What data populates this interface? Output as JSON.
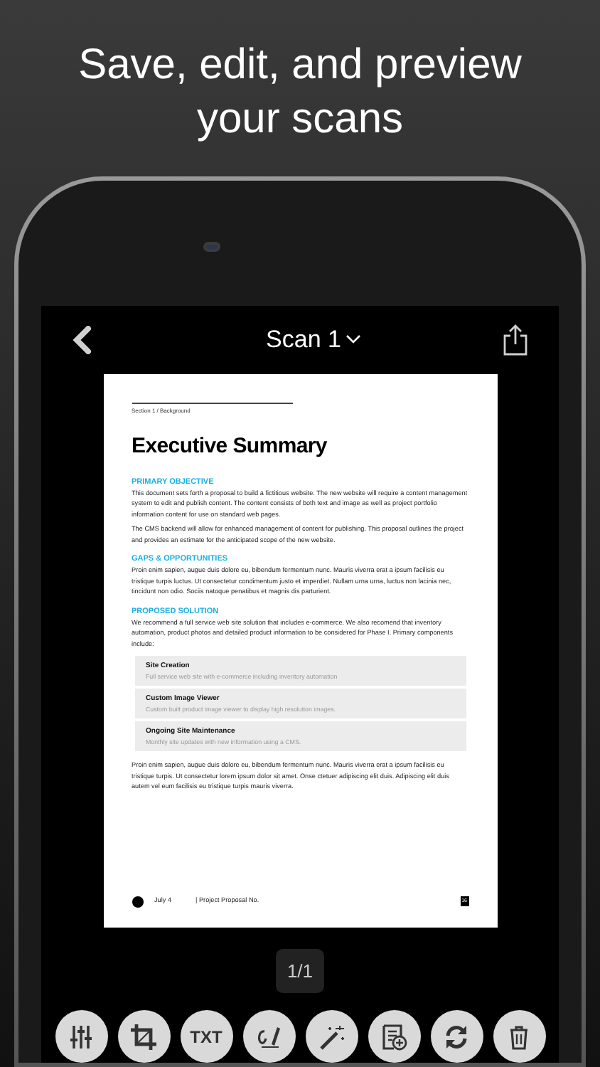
{
  "headline": "Save, edit, and preview your scans",
  "nav": {
    "title": "Scan 1"
  },
  "document": {
    "section_label": "Section 1 / Background",
    "title": "Executive Summary",
    "sections": [
      {
        "heading": "PRIMARY OBJECTIVE",
        "paragraphs": [
          "This document sets forth a proposal to build a fictitious website. The new website will require a content management system to edit and publish content. The content consists of both text and image as well as project portfolio information content for use on standard web pages.",
          "The CMS backend will allow for enhanced management of content for publishing. This proposal outlines the project and provides an estimate for the anticipated scope of the new website."
        ]
      },
      {
        "heading": "GAPS & OPPORTUNITIES",
        "paragraphs": [
          "Proin enim sapien, augue duis dolore eu, bibendum fermentum nunc. Mauris viverra erat a ipsum facilisis eu tristique turpis luctus. Ut consectetur condimentum justo et imperdiet. Nullam urna urna, luctus non lacinia nec, tincidunt non odio. Sociis natoque penatibus et magnis dis parturient."
        ]
      },
      {
        "heading": "PROPOSED SOLUTION",
        "paragraphs": [
          "We recommend a full service web site solution that includes e-commerce. We also recomend that inventory automation, product photos and detailed product information to be considered for Phase I. Primary components include:"
        ],
        "components": [
          {
            "title": "Site Creation",
            "description": "Full service web site with e-commerce including inventory automation"
          },
          {
            "title": "Custom Image Viewer",
            "description": "Custom built product image viewer to display high resolution images."
          },
          {
            "title": "Ongoing Site Maintenance",
            "description": "Monthly site updates with new information using a CMS."
          }
        ]
      }
    ],
    "closing": "Proin enim sapien, augue duis dolore eu, bibendum fermentum nunc. Mauris viverra erat a ipsum facilisis eu tristique turpis. Ut consectetur lorem ipsum dolor sit amet. Onse ctetuer adipiscing elit duis. Adipiscing elit duis autem vel eum facilisis eu tristique turpis mauris viverra.",
    "footer": {
      "date": "July 4",
      "project": "| Project Proposal No.",
      "page": "16"
    }
  },
  "page_counter": "1/1",
  "toolbar": [
    {
      "kind": "adjust"
    },
    {
      "kind": "crop"
    },
    {
      "kind": "text",
      "label": "TXT"
    },
    {
      "kind": "signature"
    },
    {
      "kind": "magic"
    },
    {
      "kind": "add-note"
    },
    {
      "kind": "rotate"
    },
    {
      "kind": "delete"
    }
  ]
}
